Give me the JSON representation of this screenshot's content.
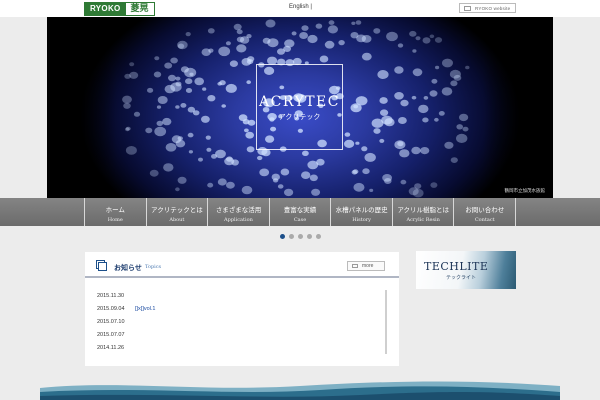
{
  "header": {
    "logo_en": "RYOKO",
    "logo_jp": "菱晃",
    "language_link": "English |",
    "website_button": "RYOKO website"
  },
  "hero": {
    "title": "ACRYTEC",
    "subtitle": "アクリテック",
    "caption": "鶴岡市立加茂水族館"
  },
  "nav": {
    "items": [
      {
        "jp": "ホーム",
        "en": "Home"
      },
      {
        "jp": "アクリテックとは",
        "en": "About"
      },
      {
        "jp": "さまざまな活用",
        "en": "Application"
      },
      {
        "jp": "豊富な実績",
        "en": "Case"
      },
      {
        "jp": "水槽パネルの歴史",
        "en": "History"
      },
      {
        "jp": "アクリル樹脂とは",
        "en": "Acrylic Resin"
      },
      {
        "jp": "お問い合わせ",
        "en": "Contact"
      }
    ]
  },
  "slider": {
    "count": 5,
    "active_index": 0
  },
  "news": {
    "title": "お知らせ",
    "subtitle": "Topics",
    "more_label": "more",
    "items": [
      {
        "date": "2015.11.30",
        "text": ""
      },
      {
        "date": "2015.09.04",
        "text": "[]x[]vol.1"
      },
      {
        "date": "2015.07.10",
        "text": ""
      },
      {
        "date": "2015.07.07",
        "text": ""
      },
      {
        "date": "2014.11.26",
        "text": ""
      }
    ]
  },
  "banner": {
    "title": "TECHLITE",
    "subtitle": "テックライト"
  },
  "colors": {
    "brand_green": "#2f7a35",
    "accent_blue": "#1c4f8a",
    "nav_band": "#7a7a7a"
  }
}
